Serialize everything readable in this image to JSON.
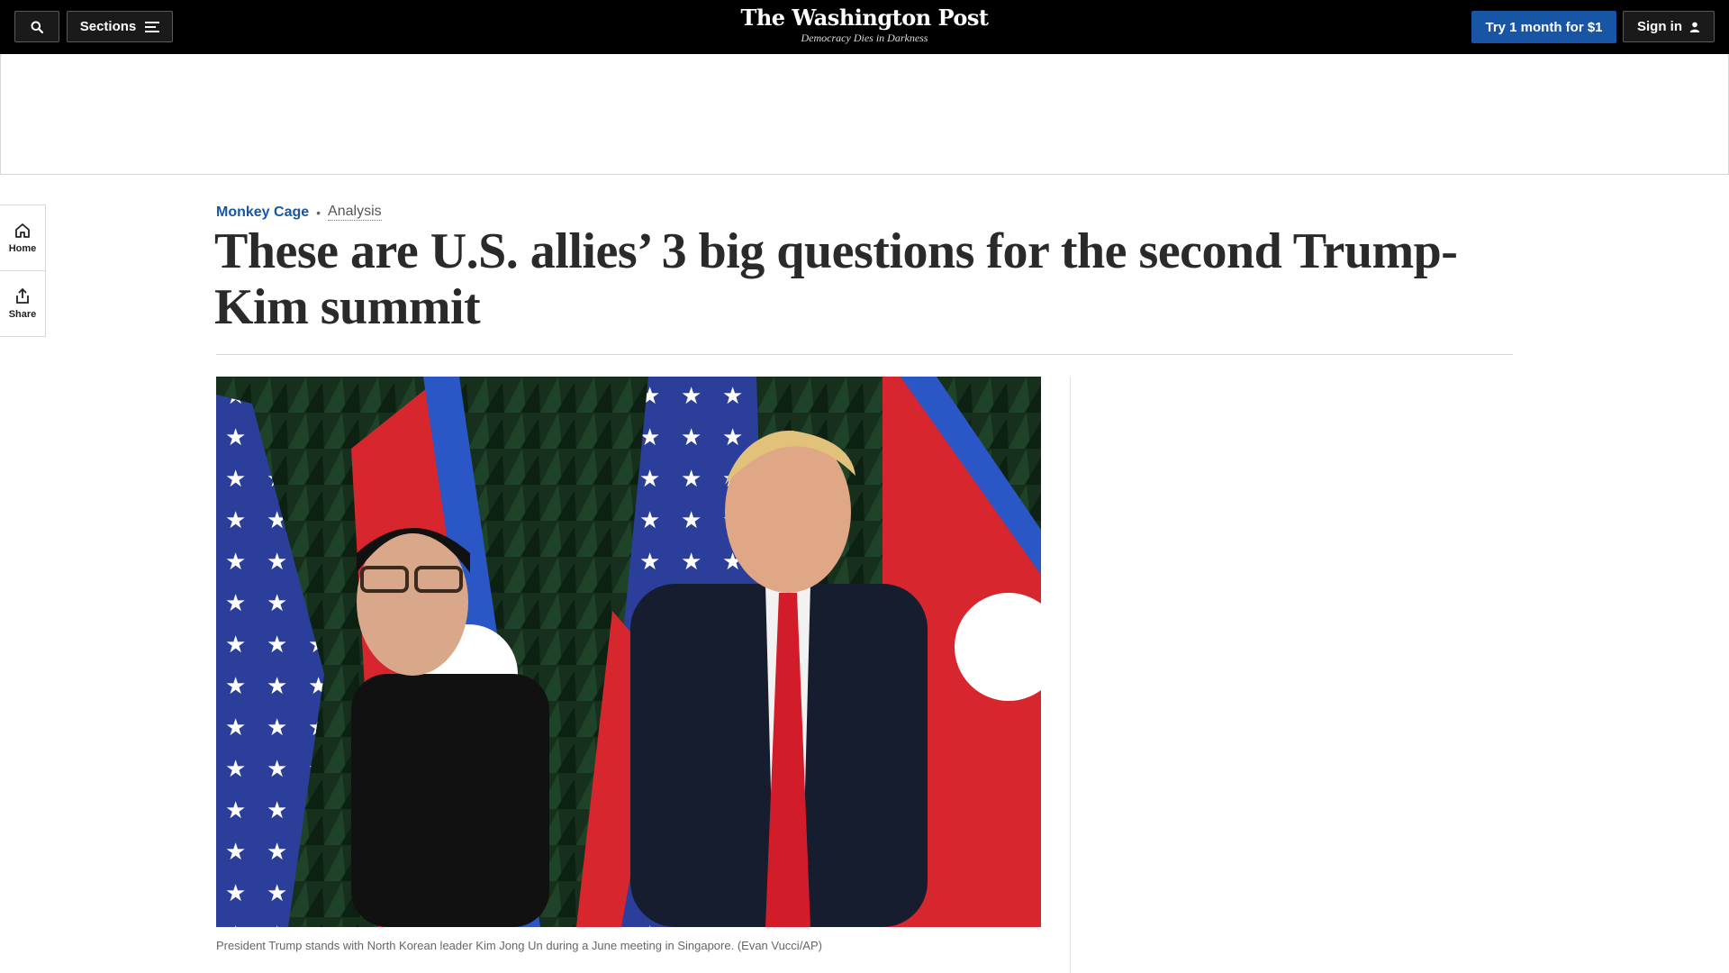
{
  "header": {
    "sections_label": "Sections",
    "logo_text": "The Washington Post",
    "tagline": "Democracy Dies in Darkness",
    "subscribe_label": "Try 1 month for $1",
    "signin_label": "Sign in"
  },
  "rail": {
    "home_label": "Home",
    "share_label": "Share"
  },
  "article": {
    "section": "Monkey Cage",
    "label": "Analysis",
    "headline": "These are U.S. allies’ 3 big questions for the second Trump-Kim summit",
    "caption": "President Trump stands with North Korean leader Kim Jong Un during a June meeting in Singapore. (Evan Vucci/AP)"
  },
  "colors": {
    "accent": "#1955a5",
    "topbar": "#000000"
  }
}
